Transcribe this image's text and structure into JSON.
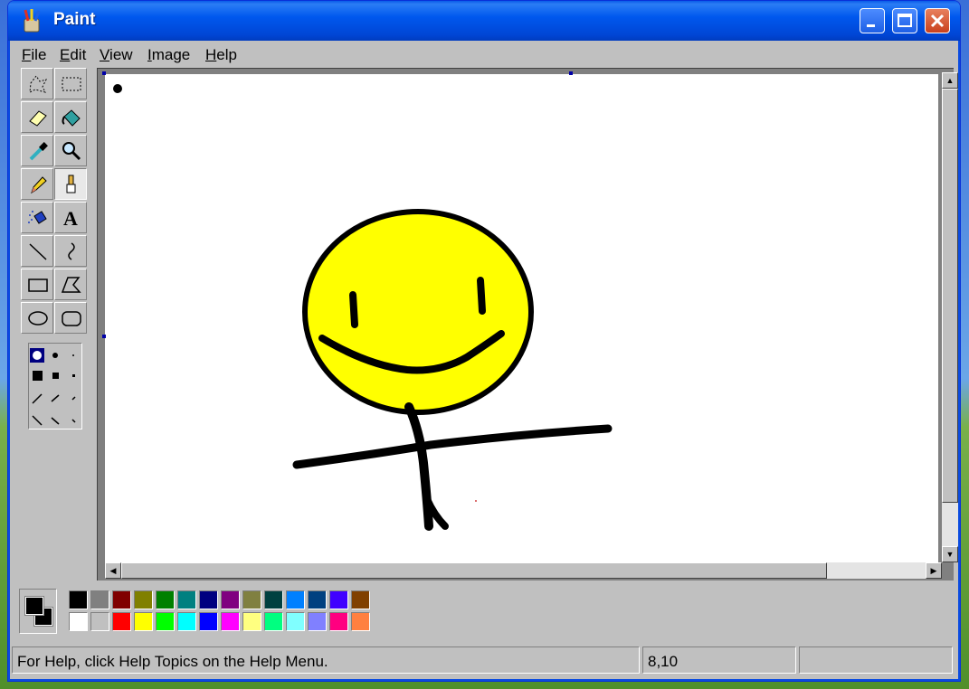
{
  "window": {
    "title": "Paint"
  },
  "menu": [
    {
      "id": "file",
      "label": "File"
    },
    {
      "id": "edit",
      "label": "Edit"
    },
    {
      "id": "view",
      "label": "View"
    },
    {
      "id": "image",
      "label": "Image"
    },
    {
      "id": "help",
      "label": "Help"
    }
  ],
  "tools": [
    {
      "name": "free-form-select-icon",
      "active": false
    },
    {
      "name": "rect-select-icon",
      "active": false
    },
    {
      "name": "eraser-icon",
      "active": false
    },
    {
      "name": "fill-bucket-icon",
      "active": false
    },
    {
      "name": "color-picker-icon",
      "active": false
    },
    {
      "name": "magnifier-icon",
      "active": false
    },
    {
      "name": "pencil-icon",
      "active": false
    },
    {
      "name": "brush-icon",
      "active": true
    },
    {
      "name": "airbrush-icon",
      "active": false
    },
    {
      "name": "text-icon",
      "active": false,
      "glyph": "A"
    },
    {
      "name": "line-icon",
      "active": false
    },
    {
      "name": "curve-icon",
      "active": false
    },
    {
      "name": "rectangle-icon",
      "active": false
    },
    {
      "name": "polygon-icon",
      "active": false
    },
    {
      "name": "ellipse-icon",
      "active": false
    },
    {
      "name": "rounded-rect-icon",
      "active": false
    }
  ],
  "colors": {
    "foreground": "#000000",
    "background": "#000000",
    "palette_top": [
      "#000000",
      "#808080",
      "#800000",
      "#808000",
      "#008000",
      "#008080",
      "#000080",
      "#800080",
      "#808040",
      "#004040",
      "#0080ff",
      "#004080",
      "#4000ff",
      "#804000"
    ],
    "palette_bottom": [
      "#ffffff",
      "#c0c0c0",
      "#ff0000",
      "#ffff00",
      "#00ff00",
      "#00ffff",
      "#0000ff",
      "#ff00ff",
      "#ffff80",
      "#00ff80",
      "#80ffff",
      "#8080ff",
      "#ff0080",
      "#ff8040"
    ]
  },
  "status": {
    "help_text": "For Help, click Help Topics on the Help Menu.",
    "coordinates": "8,10",
    "size": ""
  }
}
